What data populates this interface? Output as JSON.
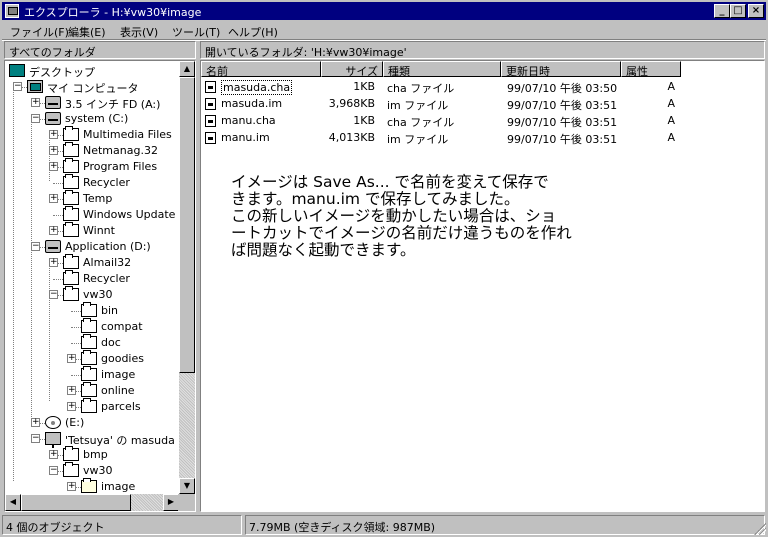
{
  "window": {
    "title": "エクスプローラ - H:¥vw30¥image",
    "min_label": "_",
    "max_label": "□",
    "close_label": "×"
  },
  "menu": [
    {
      "label": "ファイル(F)"
    },
    {
      "label": "編集(E)"
    },
    {
      "label": "表示(V)"
    },
    {
      "label": "ツール(T)"
    },
    {
      "label": "ヘルプ(H)"
    }
  ],
  "tree_header": "すべてのフォルダ",
  "list_header": "開いているフォルダ: 'H:¥vw30¥image'",
  "tree": [
    {
      "label": "デスクトップ",
      "icon": "desktop-icon",
      "expander": ""
    },
    {
      "label": "マイ コンピュータ",
      "icon": "computer-icon",
      "expander": "−"
    },
    {
      "label": "3.5 インチ FD (A:)",
      "icon": "floppy-drive-icon",
      "expander": "+"
    },
    {
      "label": "system (C:)",
      "icon": "hard-drive-icon",
      "expander": "−"
    },
    {
      "label": "Multimedia Files",
      "icon": "folder-icon",
      "expander": "+"
    },
    {
      "label": "Netmanag.32",
      "icon": "folder-icon",
      "expander": "+"
    },
    {
      "label": "Program Files",
      "icon": "folder-icon",
      "expander": "+"
    },
    {
      "label": "Recycler",
      "icon": "folder-icon",
      "expander": ""
    },
    {
      "label": "Temp",
      "icon": "folder-icon",
      "expander": "+"
    },
    {
      "label": "Windows Update S",
      "icon": "folder-icon",
      "expander": ""
    },
    {
      "label": "Winnt",
      "icon": "folder-icon",
      "expander": "+"
    },
    {
      "label": "Application (D:)",
      "icon": "hard-drive-icon",
      "expander": "−"
    },
    {
      "label": "Almail32",
      "icon": "folder-icon",
      "expander": "+"
    },
    {
      "label": "Recycler",
      "icon": "folder-icon",
      "expander": ""
    },
    {
      "label": "vw30",
      "icon": "folder-icon",
      "expander": "−"
    },
    {
      "label": "bin",
      "icon": "folder-icon",
      "expander": ""
    },
    {
      "label": "compat",
      "icon": "folder-icon",
      "expander": ""
    },
    {
      "label": "doc",
      "icon": "folder-icon",
      "expander": ""
    },
    {
      "label": "goodies",
      "icon": "folder-icon",
      "expander": "+"
    },
    {
      "label": "image",
      "icon": "folder-icon",
      "expander": ""
    },
    {
      "label": "online",
      "icon": "folder-icon",
      "expander": "+"
    },
    {
      "label": "parcels",
      "icon": "folder-icon",
      "expander": "+"
    },
    {
      "label": "(E:)",
      "icon": "cdrom-icon",
      "expander": "+"
    },
    {
      "label": "'Tetsuya' の masuda (",
      "icon": "network-drive-icon",
      "expander": "−"
    },
    {
      "label": "bmp",
      "icon": "folder-icon",
      "expander": "+"
    },
    {
      "label": "vw30",
      "icon": "folder-icon",
      "expander": "−"
    },
    {
      "label": "image",
      "icon": "open-folder-icon",
      "expander": "+"
    }
  ],
  "columns": [
    {
      "label": "名前"
    },
    {
      "label": "サイズ"
    },
    {
      "label": "種類"
    },
    {
      "label": "更新日時"
    },
    {
      "label": "属性"
    }
  ],
  "files": [
    {
      "name": "masuda.cha",
      "size": "1KB",
      "type": "cha ファイル",
      "modified": "99/07/10 午後 03:50",
      "attr": "A"
    },
    {
      "name": "masuda.im",
      "size": "3,968KB",
      "type": "im ファイル",
      "modified": "99/07/10 午後 03:51",
      "attr": "A"
    },
    {
      "name": "manu.cha",
      "size": "1KB",
      "type": "cha ファイル",
      "modified": "99/07/10 午後 03:51",
      "attr": "A"
    },
    {
      "name": "manu.im",
      "size": "4,013KB",
      "type": "im ファイル",
      "modified": "99/07/10 午後 03:51",
      "attr": "A"
    }
  ],
  "note_lines": [
    "イメージは Save As... で名前を変えて保存で",
    "きます。manu.im で保存してみました。",
    "この新しいイメージを動かしたい場合は、ショ",
    "ートカットでイメージの名前だけ違うものを作れ",
    "ば問題なく起動できます。"
  ],
  "status": {
    "objects": "4 個のオブジェクト",
    "size": "7.79MB (空きディスク領域: 987MB)"
  }
}
